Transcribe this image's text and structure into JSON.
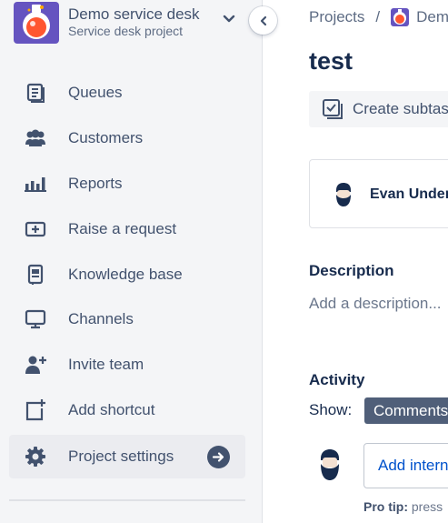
{
  "colors": {
    "sidebar_bg": "#f4f5f7",
    "accent": "#0052cc",
    "project_avatar": "#6554c0",
    "pill_bg": "#505f79"
  },
  "project": {
    "name": "Demo service desk",
    "type": "Service desk project",
    "avatar_icon": "potion-flask-icon"
  },
  "sidebar": {
    "items": [
      {
        "label": "Queues",
        "icon": "queues-icon"
      },
      {
        "label": "Customers",
        "icon": "customers-icon"
      },
      {
        "label": "Reports",
        "icon": "reports-icon"
      },
      {
        "label": "Raise a request",
        "icon": "raise-request-icon"
      },
      {
        "label": "Knowledge base",
        "icon": "knowledge-base-icon"
      },
      {
        "label": "Channels",
        "icon": "channels-icon"
      },
      {
        "label": "Invite team",
        "icon": "invite-team-icon"
      },
      {
        "label": "Add shortcut",
        "icon": "add-shortcut-icon"
      },
      {
        "label": "Project settings",
        "icon": "gear-icon",
        "active": true
      }
    ]
  },
  "breadcrumb": {
    "projects": "Projects",
    "separator": "/",
    "project": "Demo"
  },
  "issue": {
    "title": "test",
    "create_subtask": "Create subtask",
    "assignee": "Evan Underwood",
    "description_heading": "Description",
    "description_placeholder": "Add a description...",
    "activity_heading": "Activity",
    "show_label": "Show:",
    "filter_selected": "Comments",
    "comment_placeholder": "Add internal note",
    "protip_bold": "Pro tip:",
    "protip_text": "press"
  }
}
